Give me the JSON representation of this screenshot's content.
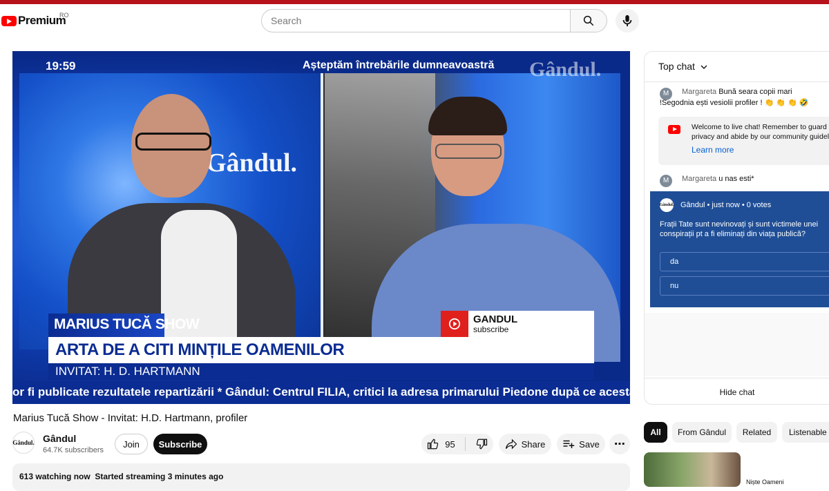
{
  "header": {
    "logo_text": "Premium",
    "country_code": "RO",
    "search_placeholder": "Search"
  },
  "video": {
    "time": "19:59",
    "overlay_title": "Așteptăm întrebările  dumneavoastră",
    "watermark": "Gândul.",
    "center_logo": "Gândul.",
    "show_name_light": "MARIUS TUCĂ ",
    "show_name_bold": "SHOW",
    "main_title": "ARTA DE A CITI MINȚILE OAMENILOR",
    "guest": "INVITAT: H. D. HARTMANN",
    "brand_name": "GANDUL",
    "brand_cta": "subscribe",
    "ticker": "or fi publicate rezultatele repartizării * Gândul: Centrul FILIA, critici la adresa primarului Piedone după ce acesta a a"
  },
  "info": {
    "title": "Marius Tucă Show - Invitat: H.D. Hartmann, profiler",
    "channel_name": "Gândul",
    "channel_avatar_text": "Gândul.",
    "subscribers": "64.7K subscribers",
    "join_label": "Join",
    "subscribe_label": "Subscribe",
    "like_count": "95",
    "share_label": "Share",
    "save_label": "Save",
    "more_label": "⋯",
    "watching": "613 watching now",
    "started": "Started streaming 3 minutes ago"
  },
  "chat": {
    "header": "Top chat",
    "messages": [
      {
        "avatar": "M",
        "author": "Margareta",
        "text": "Bună seara copii mari !Segodnia ești vesiolii profiler ! 👏 👏 👏 🤣"
      },
      {
        "avatar": "M",
        "author": "Margareta",
        "text": "u nas esti*"
      }
    ],
    "welcome_text": "Welcome to live chat! Remember to guard your privacy and abide by our community guidelines.",
    "learn_more": "Learn more",
    "poll": {
      "avatar_text": "Gândul.",
      "meta": "Gândul • just now • 0 votes",
      "question": "Frații Tate sunt nevinovați și sunt victimele unei conspirații pt a fi eliminați din viața publică?",
      "options": [
        "da",
        "nu"
      ]
    },
    "hide_chat": "Hide chat"
  },
  "chips": [
    "All",
    "From Gândul",
    "Related",
    "Listenable"
  ],
  "recommendation": {
    "title": "Niște Oameni"
  },
  "colors": {
    "accent_red": "#ff0000",
    "top_line": "#b5121b",
    "lower_third_blue": "#0b2c92",
    "poll_bg": "#1f4e96",
    "link_blue": "#065fd4"
  }
}
